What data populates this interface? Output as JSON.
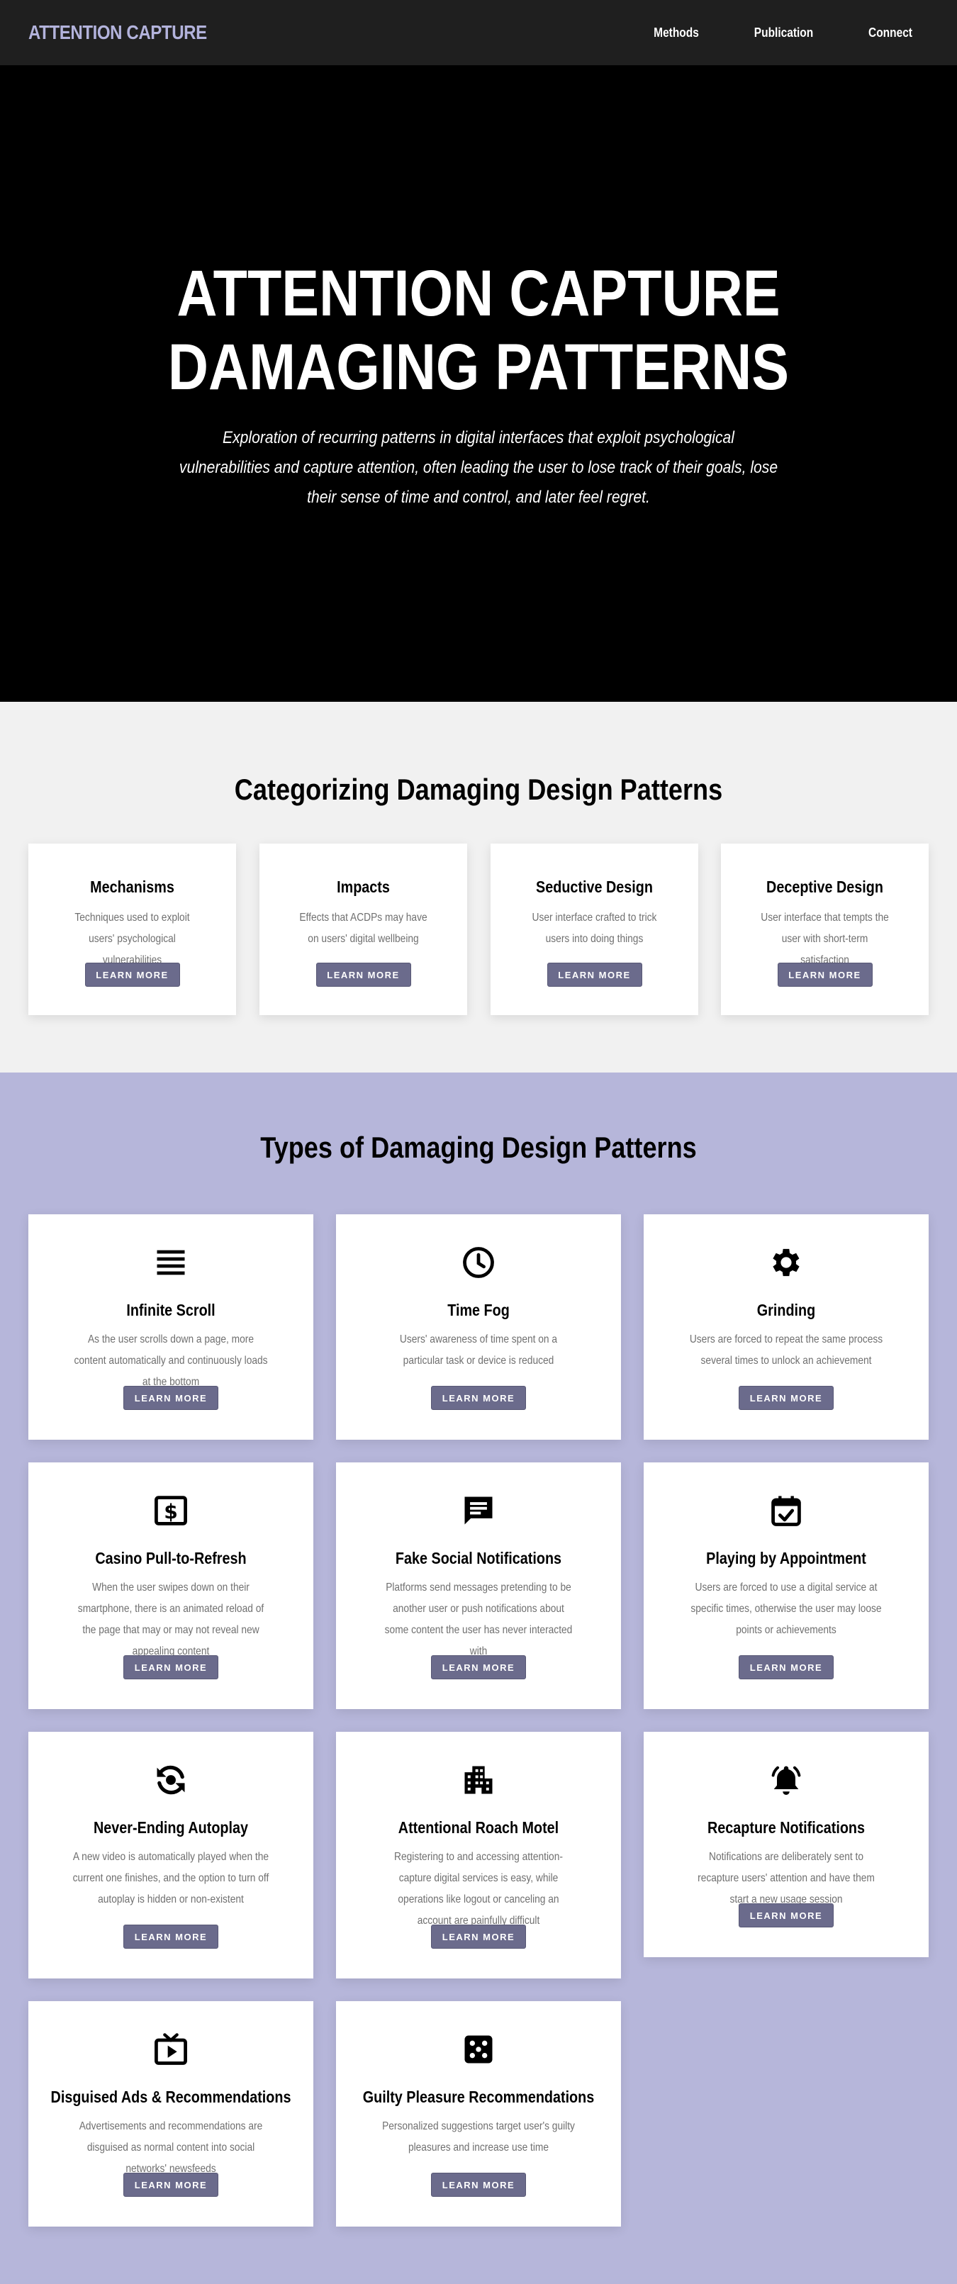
{
  "nav": {
    "brand": "ATTENTION CAPTURE",
    "links": [
      "Methods",
      "Publication",
      "Connect"
    ]
  },
  "hero": {
    "title_line1": "ATTENTION CAPTURE",
    "title_line2": "DAMAGING PATTERNS",
    "subtitle": "Exploration of recurring patterns in digital interfaces that exploit psychological vulnerabilities and capture attention, often leading the user to lose track of their goals, lose their sense of time and control, and later feel regret."
  },
  "categories": {
    "title": "Categorizing Damaging Design Patterns",
    "items": [
      {
        "title": "Mechanisms",
        "desc": "Techniques used to exploit users' psychological vulnerabilities",
        "button": "LEARN MORE"
      },
      {
        "title": "Impacts",
        "desc": "Effects that ACDPs may have on users' digital wellbeing",
        "button": "LEARN MORE"
      },
      {
        "title": "Seductive Design",
        "desc": "User interface crafted to trick users into doing things",
        "button": "LEARN MORE"
      },
      {
        "title": "Deceptive Design",
        "desc": "User interface that tempts the user with short-term satisfaction",
        "button": "LEARN MORE"
      }
    ]
  },
  "types": {
    "title": "Types of Damaging Design Patterns",
    "items": [
      {
        "icon": "list-icon",
        "title": "Infinite Scroll",
        "desc": "As the user scrolls down a page, more content automatically and continuously loads at the bottom",
        "button": "LEARN MORE"
      },
      {
        "icon": "clock-icon",
        "title": "Time Fog",
        "desc": "Users' awareness of time spent on a particular task or device is reduced",
        "button": "LEARN MORE"
      },
      {
        "icon": "gear-icon",
        "title": "Grinding",
        "desc": "Users are forced to repeat the same process several times to unlock an achievement",
        "button": "LEARN MORE"
      },
      {
        "icon": "money-icon",
        "title": "Casino Pull-to-Refresh",
        "desc": "When the user swipes down on their smartphone, there is an animated reload of the page that may or may not reveal new appealing content",
        "button": "LEARN MORE"
      },
      {
        "icon": "message-icon",
        "title": "Fake Social Notifications",
        "desc": "Platforms send messages pretending to be another user or push notifications about some content the user has never interacted with",
        "button": "LEARN MORE"
      },
      {
        "icon": "calendar-check-icon",
        "title": "Playing by Appointment",
        "desc": "Users are forced to use a digital service at specific times, otherwise the user may loose points or achievements",
        "button": "LEARN MORE"
      },
      {
        "icon": "autoplay-icon",
        "title": "Never-Ending Autoplay",
        "desc": "A new video is automatically played when the current one finishes, and the option to turn off autoplay is hidden or non-existent",
        "button": "LEARN MORE"
      },
      {
        "icon": "building-icon",
        "title": "Attentional Roach Motel",
        "desc": "Registering to and accessing attention-capture digital services is easy, while operations like logout or canceling an account are painfully difficult",
        "button": "LEARN MORE"
      },
      {
        "icon": "bell-ring-icon",
        "title": "Recapture Notifications",
        "desc": "Notifications are deliberately sent to recapture users' attention and have them start a new usage session",
        "button": "LEARN MORE"
      },
      {
        "icon": "tv-play-icon",
        "title": "Disguised Ads & Recommendations",
        "desc": "Advertisements and recommendations are disguised as normal content into social networks' newsfeeds",
        "button": "LEARN MORE"
      },
      {
        "icon": "dice-icon",
        "title": "Guilty Pleasure Recommendations",
        "desc": "Personalized suggestions target user's guilty pleasures and increase use time",
        "button": "LEARN MORE"
      }
    ]
  },
  "colors": {
    "nav_bg": "#1f1f1f",
    "brand": "#b3b3dc",
    "hero_bg": "#000000",
    "categories_bg": "#f1f1f1",
    "types_bg": "#b6b6da",
    "button_bg": "#6b6b8c"
  }
}
